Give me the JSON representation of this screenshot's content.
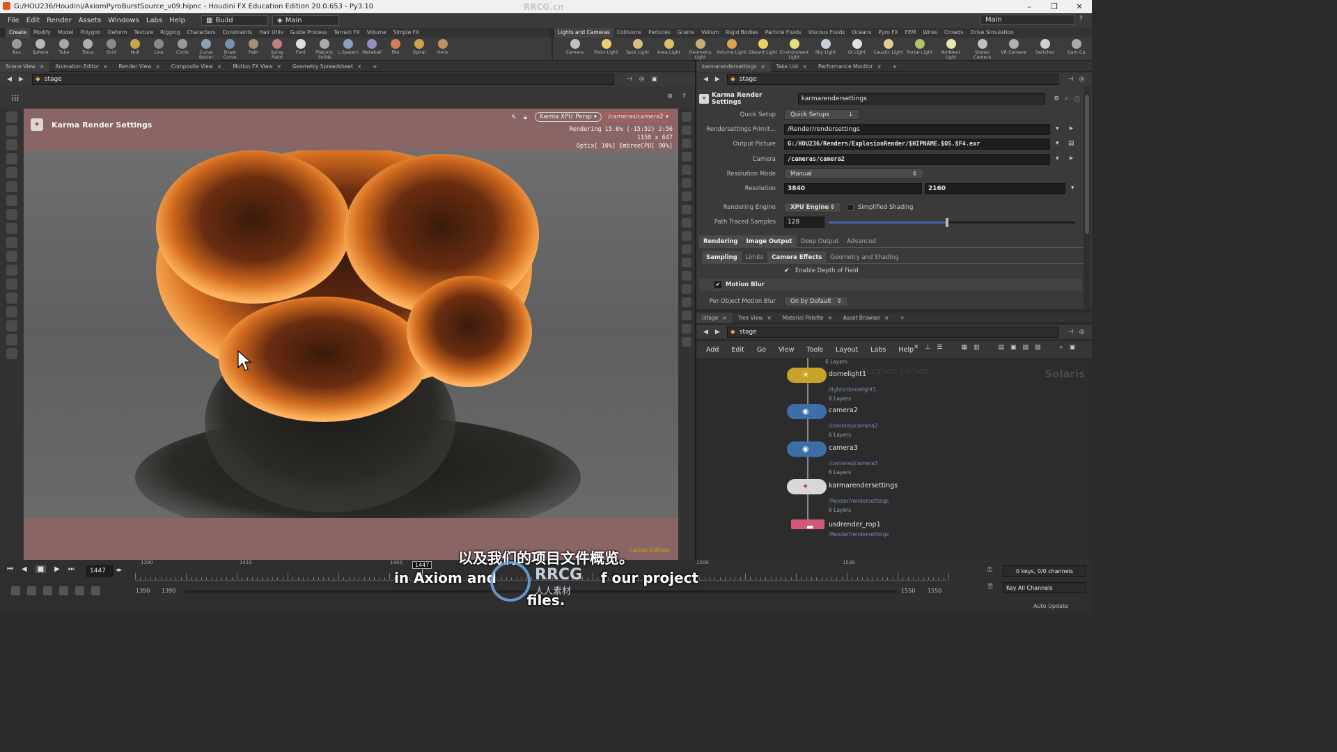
{
  "window": {
    "title": "G:/HOU236/Houdini/AxiomPyroBurstSource_v09.hipnc - Houdini FX Education Edition 20.0.653 - Py3.10",
    "min": "–",
    "max": "❐",
    "close": "✕"
  },
  "menu": {
    "items": [
      "File",
      "Edit",
      "Render",
      "Assets",
      "Windows",
      "Labs",
      "Help"
    ],
    "desktop": "Build",
    "context": "Main",
    "right_context": "Main"
  },
  "shelf_left": {
    "tabs": [
      "Create",
      "Modify",
      "Model",
      "Polygon",
      "Deform",
      "Texture",
      "Rigging",
      "Characters",
      "Constraints",
      "Hair Utils",
      "Guide Process",
      "Terrain FX",
      "Volume",
      "Simple FX"
    ],
    "tools": [
      "Box",
      "Sphere",
      "Tube",
      "Torus",
      "Grid",
      "Null",
      "Line",
      "Circle",
      "Curve Bezier",
      "Draw Curve",
      "Path",
      "Spray Paint",
      "Font",
      "Platonic Solids",
      "L-System",
      "Metaball",
      "File",
      "Spiral",
      "Helix"
    ]
  },
  "shelf_right": {
    "tabs": [
      "Lights and Cameras",
      "Collisions",
      "Particles",
      "Grains",
      "Vellum",
      "Rigid Bodies",
      "Particle Fluids",
      "Viscous Fluids",
      "Oceans",
      "Pyro FX",
      "FEM",
      "Wires",
      "Crowds",
      "Drive Simulation"
    ],
    "tools": [
      "Camera",
      "Point Light",
      "Spot Light",
      "Area Light",
      "Geometry Light",
      "Volume Light",
      "Distant Light",
      "Environment Light",
      "Sky Light",
      "GI Light",
      "Caustic Light",
      "Portal Light",
      "Ambient Light",
      "Stereo Camera",
      "VR Camera",
      "Switcher",
      "Gam Ca"
    ]
  },
  "left_pane": {
    "tabs": [
      "Scene View",
      "Animation Editor",
      "Render View",
      "Composite View",
      "Motion FX View",
      "Geometry Spreadsheet"
    ],
    "path": "stage"
  },
  "viewport": {
    "title": "Karma Render Settings",
    "renderer": "Karma XPU",
    "persp": "Persp",
    "camera": "/cameras/camera2",
    "status_line1": "Rendering  15.6%  (-15:52)  2:56",
    "status_line2": "1150 x 647",
    "status_line3": "Optix[ 10%] EmbreeCPU[ 90%]",
    "watermark": "cation Edition"
  },
  "right_top": {
    "tabs": [
      "karmarendersettings",
      "Take List",
      "Performance Monitor"
    ],
    "path": "stage",
    "node_type": "Karma Render Settings",
    "node_name": "karmarendersettings",
    "params": {
      "quick_setup_label": "Quick Setup",
      "quick_setup": "Quick Setups",
      "rs_prim_label": "Rendersettings Primit...",
      "rs_prim": "/Render/rendersettings",
      "output_label": "Output Picture",
      "output": "G:/HOU236/Renders/ExplosionRender/$HIPNAME.$OS.$F4.exr",
      "camera_label": "Camera",
      "camera": "/cameras/camera2",
      "resmode_label": "Resolution Mode",
      "resmode": "Manual",
      "res_label": "Resolution",
      "res_x": "3840",
      "res_y": "2160",
      "engine_label": "Rendering Engine",
      "engine": "XPU Engine",
      "simplified": "Simplified Shading",
      "pts_label": "Path Traced Samples",
      "pts": "128",
      "tabs1": [
        "Rendering",
        "Image Output",
        "Deep Output",
        "Advanced"
      ],
      "tabs2": [
        "Sampling",
        "Limits",
        "Camera Effects",
        "Geometry and Shading"
      ],
      "dof": "Enable Depth of Field",
      "mb": "Motion Blur",
      "pomb_label": "Per-Object Motion Blur",
      "pomb": "On by Default"
    }
  },
  "right_bottom": {
    "tabs": [
      "/stage",
      "Tree View",
      "Material Palette",
      "Asset Browser"
    ],
    "path": "stage",
    "menu": [
      "Add",
      "Edit",
      "Go",
      "View",
      "Tools",
      "Layout",
      "Labs",
      "Help"
    ],
    "watermark": "Solaris",
    "watermark2": "ducation Edition",
    "top_layers": "6 Layers",
    "nodes": [
      {
        "name": "domelight1",
        "path": "/lights/domelight1",
        "layers": "6 Layers"
      },
      {
        "name": "camera2",
        "path": "/cameras/camera2",
        "layers": "6 Layers"
      },
      {
        "name": "camera3",
        "path": "/cameras/camera3",
        "layers": "6 Layers"
      },
      {
        "name": "karmarendersettings",
        "path": "/Render/rendersettings",
        "layers": "6 Layers"
      },
      {
        "name": "usdrender_rop1",
        "path": "/Render/rendersettings",
        "layers": ""
      }
    ]
  },
  "timeline": {
    "frame": "1447",
    "marker": "1447",
    "ticks": [
      "1390",
      "1410",
      "1440",
      "1500",
      "1530"
    ],
    "start": "1390",
    "start2": "1390",
    "end": "1550",
    "end2": "1550",
    "keys": "0 keys, 0/0 channels",
    "key_all": "Key All Channels",
    "auto_update": "Auto Update"
  },
  "subtitle": {
    "cn": "以及我们的项目文件概览。",
    "en1": "in Axiom and",
    "en2": "f our project",
    "en3": "files.",
    "logo": "RRCG",
    "logo_sub": "人人素材",
    "top_logo": "RRCG.cn"
  },
  "progress": {
    "path_traced_slider": 0.48,
    "render_progress": 0.156
  }
}
